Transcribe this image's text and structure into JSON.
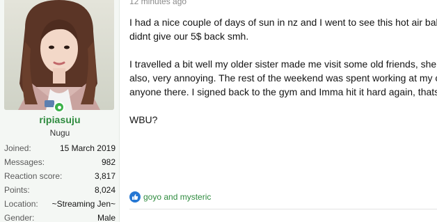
{
  "user": {
    "avatar_alt": "avatar",
    "username": "ripiasuju",
    "title": "Nugu",
    "stats": [
      {
        "label": "Joined:",
        "value": "15 March 2019"
      },
      {
        "label": "Messages:",
        "value": "982"
      },
      {
        "label": "Reaction score:",
        "value": "3,817"
      },
      {
        "label": "Points:",
        "value": "8,024"
      },
      {
        "label": "Location:",
        "value": "~Streaming Jen~"
      },
      {
        "label": "Gender:",
        "value": "Male"
      }
    ],
    "online_status": "online-icon"
  },
  "post": {
    "timestamp": "12 minutes ago",
    "lines": [
      "I had a nice couple of days of sun in nz and I went to see this hot air balloon",
      "didnt give our 5$ back smh.",
      "",
      "I travelled a bit well my older sister made me visit some old friends, she",
      "also, very annoying. The rest of the weekend was spent working at my o",
      "anyone there. I signed back to the gym and Imma hit it hard again, thats",
      "",
      "WBU?"
    ],
    "reactions": {
      "icon": "like-icon",
      "text": "goyo and mysteric"
    }
  },
  "colors": {
    "username": "#2e8b3e",
    "link": "#2e8b3e",
    "like": "#2577d3",
    "online": "#3db14a",
    "panel_bg": "#f4f7f4"
  }
}
